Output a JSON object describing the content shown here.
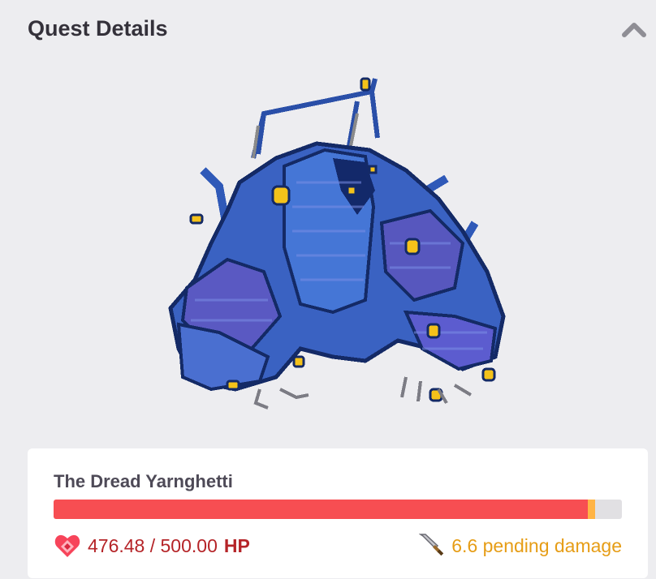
{
  "header": {
    "title": "Quest Details",
    "collapse_icon": "chevron-up-icon"
  },
  "boss": {
    "name": "The Dread Yarnghetti",
    "art_icon": "yarnghetti-boss-pixel-art",
    "hp_current": 476.48,
    "hp_max": 500.0,
    "hp_text": "476.48 / 500.00",
    "hp_unit": "HP",
    "pending_damage_text": "6.6 pending damage",
    "pending_damage": 6.6,
    "hp_icon": "heart-shield-icon",
    "pending_icon": "sword-icon"
  },
  "colors": {
    "hp_bar": "#f74e52",
    "pending_bar": "#ffb445",
    "hp_text": "#b52428",
    "pending_text": "#e69d16",
    "boss_blue": "#3a62c2"
  }
}
